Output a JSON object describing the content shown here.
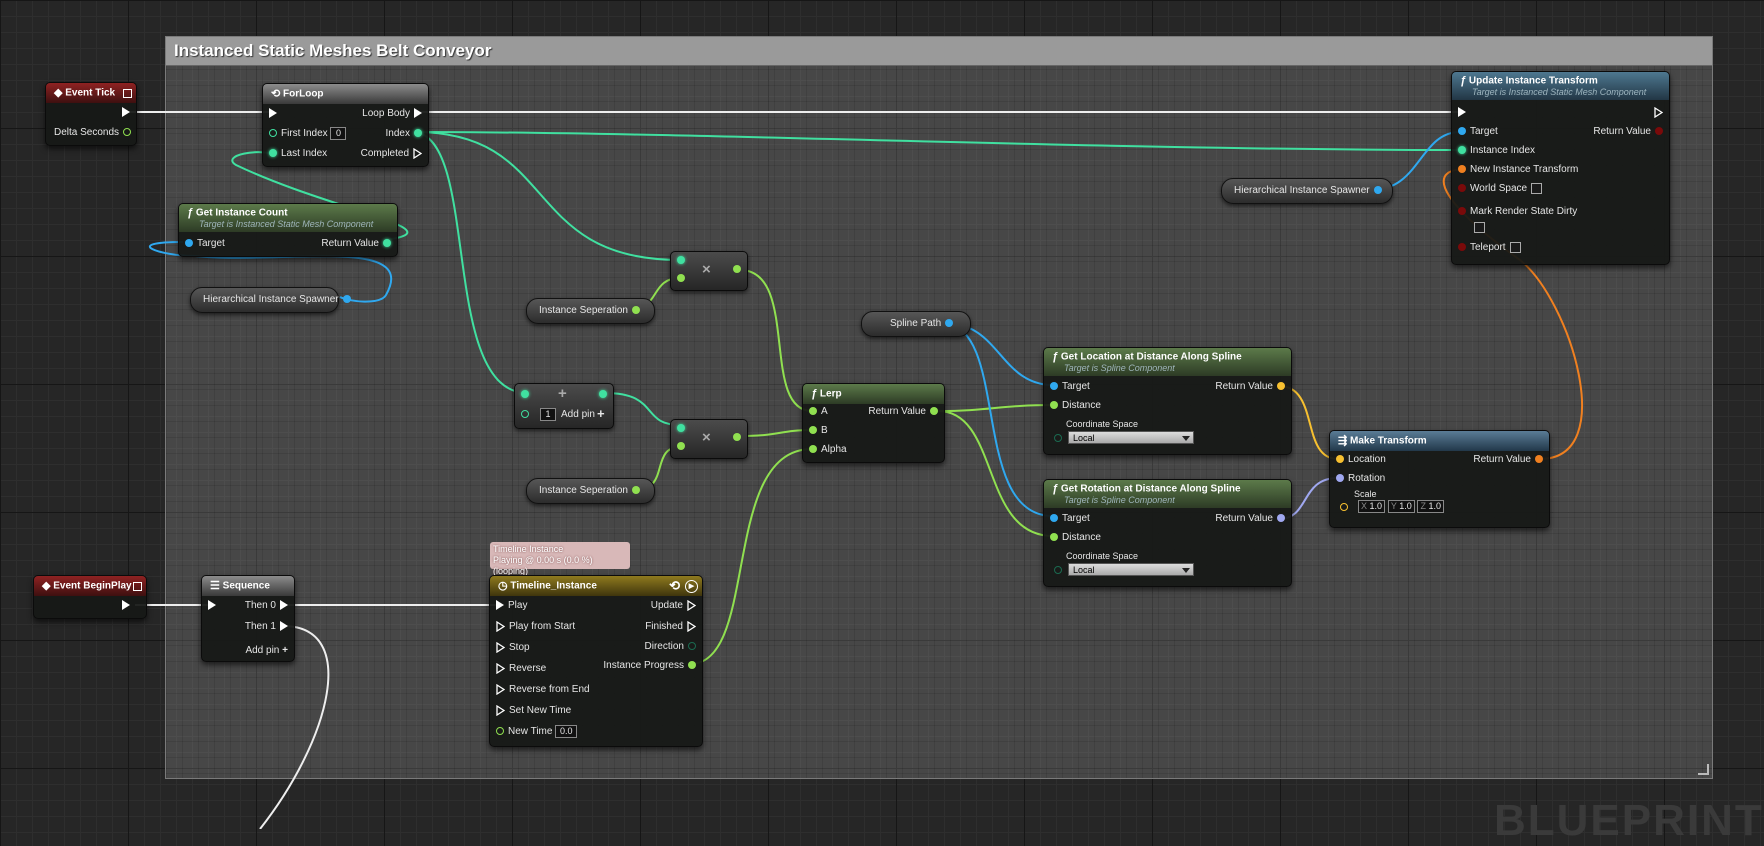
{
  "comment": {
    "title": "Instanced Static Meshes Belt Conveyor"
  },
  "watermark": "BLUEPRINT",
  "event_tick": {
    "title": "Event Tick",
    "delta": "Delta Seconds"
  },
  "event_beginplay": {
    "title": "Event BeginPlay"
  },
  "forloop": {
    "title": "ForLoop",
    "loop_body": "Loop Body",
    "first_index": "First Index",
    "first_index_val": "0",
    "index": "Index",
    "last_index": "Last Index",
    "completed": "Completed"
  },
  "get_instance_count": {
    "title": "Get Instance Count",
    "subtitle": "Target is Instanced Static Mesh Component",
    "target": "Target",
    "return": "Return Value"
  },
  "hism_var_1": "Hierarchical Instance Spawner",
  "hism_var_2": "Hierarchical Instance Spawner",
  "instance_sep_1": "Instance Seperation",
  "instance_sep_2": "Instance Seperation",
  "add_node": {
    "value": "1",
    "add_pin": "Add pin"
  },
  "multiply_symbol": "×",
  "plus_symbol": "+",
  "lerp": {
    "title": "Lerp",
    "a": "A",
    "b": "B",
    "alpha": "Alpha",
    "return": "Return Value"
  },
  "spline_path": "Spline Path",
  "get_location": {
    "title": "Get Location at Distance Along Spline",
    "subtitle": "Target is Spline Component",
    "target": "Target",
    "distance": "Distance",
    "coord": "Coordinate Space",
    "coord_val": "Local",
    "return": "Return Value"
  },
  "get_rotation": {
    "title": "Get Rotation at Distance Along Spline",
    "subtitle": "Target is Spline Component",
    "target": "Target",
    "distance": "Distance",
    "coord": "Coordinate Space",
    "coord_val": "Local",
    "return": "Return Value"
  },
  "make_transform": {
    "title": "Make Transform",
    "location": "Location",
    "rotation": "Rotation",
    "scale": "Scale",
    "x_label": "X",
    "x": "1.0",
    "y_label": "Y",
    "y": "1.0",
    "z_label": "Z",
    "z": "1.0",
    "return": "Return Value"
  },
  "update_instance": {
    "title": "Update Instance Transform",
    "subtitle": "Target is Instanced Static Mesh Component",
    "target": "Target",
    "index": "Instance Index",
    "transform": "New Instance Transform",
    "world": "World Space",
    "dirty": "Mark Render State Dirty",
    "teleport": "Teleport",
    "return": "Return Value"
  },
  "sequence": {
    "title": "Sequence",
    "then0": "Then 0",
    "then1": "Then 1",
    "add_pin": "Add pin"
  },
  "timeline_tooltip": {
    "line1": "Timeline Instance",
    "line2": "Playing @ 0.00 s (0.0 %)(looping)"
  },
  "timeline": {
    "title": "Timeline_Instance",
    "play": "Play",
    "play_start": "Play from Start",
    "stop": "Stop",
    "reverse": "Reverse",
    "reverse_end": "Reverse from End",
    "set_new_time": "Set New Time",
    "new_time": "New Time",
    "new_time_val": "0.0",
    "update": "Update",
    "finished": "Finished",
    "direction": "Direction",
    "progress": "Instance Progress"
  },
  "colors": {
    "exec": "#ffffff",
    "int": "#40e0a0",
    "float": "#90e050",
    "object": "#2fa8ef",
    "vector": "#f7c030",
    "rotator": "#a0a8f0",
    "transform": "#f08020"
  }
}
